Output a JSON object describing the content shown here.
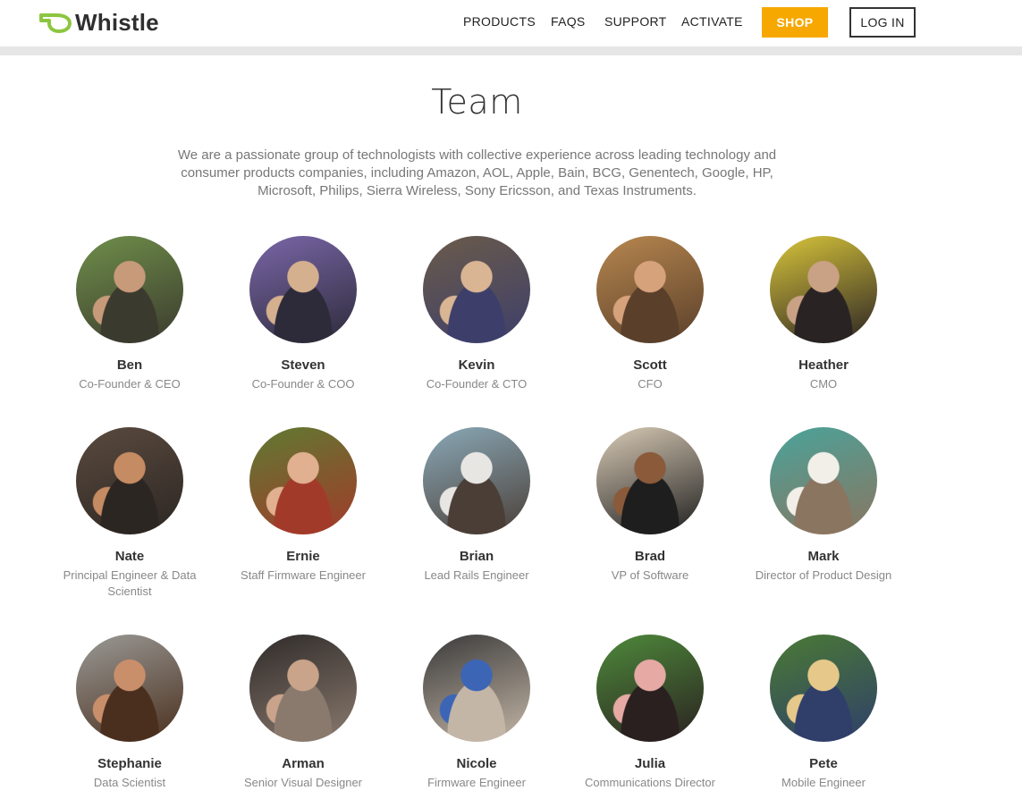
{
  "header": {
    "logo_text": "Whistle",
    "nav": [
      "PRODUCTS",
      "FAQS",
      "SUPPORT",
      "ACTIVATE"
    ],
    "shop_label": "SHOP",
    "login_label": "LOG IN",
    "accent_color": "#8cc63f",
    "shop_color": "#f7a800"
  },
  "page": {
    "title": "Team",
    "intro": "We are a passionate group of technologists with collective experience across leading technology and consumer products companies, including Amazon, AOL, Apple, Bain, BCG, Genentech, Google, HP, Microsoft, Philips, Sierra Wireless, Sony Ericsson, and Texas Instruments."
  },
  "team": [
    {
      "name": "Ben",
      "role": "Co-Founder & CEO",
      "palette": [
        "#6f8f4a",
        "#c79a7a",
        "#3b3a2e"
      ]
    },
    {
      "name": "Steven",
      "role": "Co-Founder & COO",
      "palette": [
        "#7a66a8",
        "#d4b08f",
        "#2d2b3a"
      ]
    },
    {
      "name": "Kevin",
      "role": "Co-Founder & CTO",
      "palette": [
        "#6b5b4a",
        "#d9b594",
        "#3d3f6a"
      ]
    },
    {
      "name": "Scott",
      "role": "CFO",
      "palette": [
        "#b7874f",
        "#d6a27c",
        "#5a3f2a"
      ]
    },
    {
      "name": "Heather",
      "role": "CMO",
      "palette": [
        "#d8c53a",
        "#c9a184",
        "#2a2324"
      ]
    },
    {
      "name": "Nate",
      "role": "Principal Engineer & Data Scientist",
      "palette": [
        "#5a4a3e",
        "#c58b62",
        "#2c2623"
      ]
    },
    {
      "name": "Ernie",
      "role": "Staff Firmware Engineer",
      "palette": [
        "#5f7a32",
        "#e0b090",
        "#a23a2a"
      ]
    },
    {
      "name": "Brian",
      "role": "Lead Rails Engineer",
      "palette": [
        "#8aa9b8",
        "#e8e6e3",
        "#4a3e36"
      ]
    },
    {
      "name": "Brad",
      "role": "VP of Software",
      "palette": [
        "#d9cbb6",
        "#8a5a3a",
        "#1e1e1e"
      ]
    },
    {
      "name": "Mark",
      "role": "Director of Product Design",
      "palette": [
        "#4aa39a",
        "#f2efe9",
        "#8a7560"
      ]
    },
    {
      "name": "Stephanie",
      "role": "Data Scientist",
      "palette": [
        "#9a9a96",
        "#c98f6a",
        "#4a2f1e"
      ]
    },
    {
      "name": "Arman",
      "role": "Senior Visual Designer",
      "palette": [
        "#2f2b2a",
        "#c9a38a",
        "#8a7a6e"
      ]
    },
    {
      "name": "Nicole",
      "role": "Firmware Engineer",
      "palette": [
        "#3a3a3a",
        "#3c65b6",
        "#c4b6a6"
      ]
    },
    {
      "name": "Julia",
      "role": "Communications Director",
      "palette": [
        "#4e8a3b",
        "#e6a9a4",
        "#2a2020"
      ]
    },
    {
      "name": "Pete",
      "role": "Mobile Engineer",
      "palette": [
        "#4a7a34",
        "#e6c88a",
        "#2f3f6a"
      ]
    }
  ]
}
